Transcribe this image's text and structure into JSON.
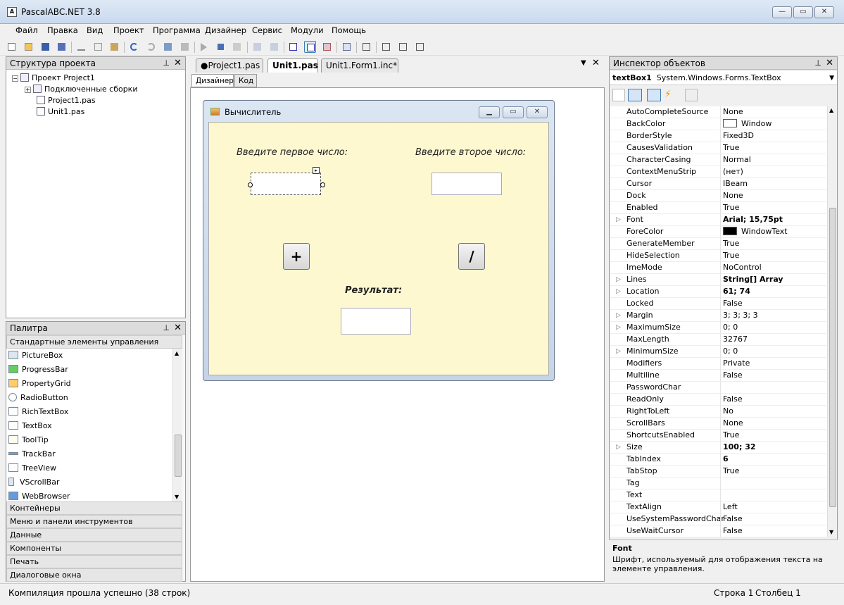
{
  "window": {
    "title": "PascalABC.NET 3.8",
    "min": "▭",
    "max": "▭",
    "close": "✕"
  },
  "menu": [
    "Файл",
    "Правка",
    "Вид",
    "Проект",
    "Программа",
    "Дизайнер",
    "Сервис",
    "Модули",
    "Помощь"
  ],
  "project_panel": {
    "title": "Структура проекта",
    "items": [
      "Проект Project1",
      "Подключенные сборки",
      "Project1.pas",
      "Unit1.pas"
    ]
  },
  "palette_panel": {
    "title": "Палитра",
    "open_category": "Стандартные элементы управления",
    "items": [
      "PictureBox",
      "ProgressBar",
      "PropertyGrid",
      "RadioButton",
      "RichTextBox",
      "TextBox",
      "ToolTip",
      "TrackBar",
      "TreeView",
      "VScrollBar",
      "WebBrowser"
    ],
    "categories": [
      "Контейнеры",
      "Меню и панели инструментов",
      "Данные",
      "Компоненты",
      "Печать",
      "Диалоговые окна"
    ]
  },
  "editor": {
    "tabs": [
      "●Project1.pas",
      "Unit1.pas",
      "Unit1.Form1.inc*"
    ],
    "subtabs": [
      "Дизайнер",
      "Код"
    ]
  },
  "form": {
    "title": "Вычислитель",
    "label1": "Введите первое число:",
    "label2": "Введите второе число:",
    "plus": "+",
    "divide": "/",
    "result_label": "Результат:"
  },
  "inspector": {
    "title": "Инспектор объектов",
    "object_name": "textBox1",
    "object_type": "System.Windows.Forms.TextBox",
    "properties": [
      {
        "name": "AutoCompleteSource",
        "value": "None"
      },
      {
        "name": "BackColor",
        "value": "Window",
        "swatch": "#ffffff"
      },
      {
        "name": "BorderStyle",
        "value": "Fixed3D"
      },
      {
        "name": "CausesValidation",
        "value": "True"
      },
      {
        "name": "CharacterCasing",
        "value": "Normal"
      },
      {
        "name": "ContextMenuStrip",
        "value": "(нет)"
      },
      {
        "name": "Cursor",
        "value": "IBeam"
      },
      {
        "name": "Dock",
        "value": "None"
      },
      {
        "name": "Enabled",
        "value": "True"
      },
      {
        "name": "Font",
        "value": "Arial; 15,75pt",
        "bold": true,
        "expandable": true
      },
      {
        "name": "ForeColor",
        "value": "WindowText",
        "swatch": "#000000"
      },
      {
        "name": "GenerateMember",
        "value": "True"
      },
      {
        "name": "HideSelection",
        "value": "True"
      },
      {
        "name": "ImeMode",
        "value": "NoControl"
      },
      {
        "name": "Lines",
        "value": "String[] Array",
        "bold": true,
        "expandable": true
      },
      {
        "name": "Location",
        "value": "61; 74",
        "bold": true,
        "expandable": true
      },
      {
        "name": "Locked",
        "value": "False"
      },
      {
        "name": "Margin",
        "value": "3; 3; 3; 3",
        "expandable": true
      },
      {
        "name": "MaximumSize",
        "value": "0; 0",
        "expandable": true
      },
      {
        "name": "MaxLength",
        "value": "32767"
      },
      {
        "name": "MinimumSize",
        "value": "0; 0",
        "expandable": true
      },
      {
        "name": "Modifiers",
        "value": "Private"
      },
      {
        "name": "Multiline",
        "value": "False"
      },
      {
        "name": "PasswordChar",
        "value": ""
      },
      {
        "name": "ReadOnly",
        "value": "False"
      },
      {
        "name": "RightToLeft",
        "value": "No"
      },
      {
        "name": "ScrollBars",
        "value": "None"
      },
      {
        "name": "ShortcutsEnabled",
        "value": "True"
      },
      {
        "name": "Size",
        "value": "100; 32",
        "bold": true,
        "expandable": true
      },
      {
        "name": "TabIndex",
        "value": "6",
        "bold": true
      },
      {
        "name": "TabStop",
        "value": "True"
      },
      {
        "name": "Tag",
        "value": ""
      },
      {
        "name": "Text",
        "value": ""
      },
      {
        "name": "TextAlign",
        "value": "Left"
      },
      {
        "name": "UseSystemPasswordChar",
        "value": "False"
      },
      {
        "name": "UseWaitCursor",
        "value": "False"
      }
    ],
    "desc_title": "Font",
    "desc_text": "Шрифт, используемый для отображения текста на элементе управления."
  },
  "status": {
    "message": "Компиляция прошла успешно (38 строк)",
    "row": "Строка  1",
    "col": "Столбец  1"
  }
}
